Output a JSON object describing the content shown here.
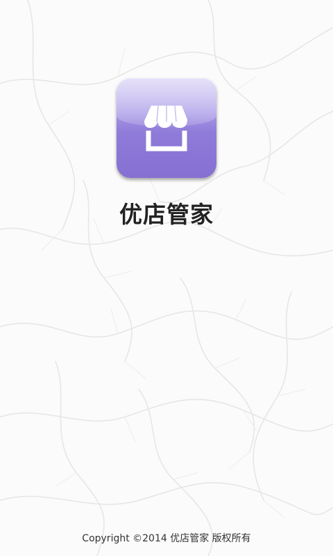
{
  "app": {
    "name": "优店管家",
    "icon": "storefront-icon",
    "icon_color": "#8f7bd9"
  },
  "footer": {
    "copyright": "Copyright ©2014 优店管家 版权所有"
  },
  "background": {
    "color": "#fbfbfb",
    "pattern": "faint tree branches"
  }
}
